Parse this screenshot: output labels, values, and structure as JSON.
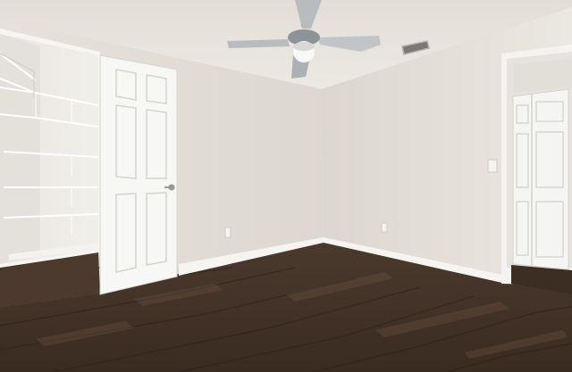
{
  "scene": {
    "description_kind": "photo",
    "room": "empty bedroom",
    "colors": {
      "ceiling": "#e9e6e0",
      "left_wall": "#e4e0d8",
      "right_wall": "#e7e3dc",
      "floor_dark": "#3a2c22",
      "floor_light": "#5a4536",
      "door": "#f7f7f5",
      "baseboard": "#f5f4f1",
      "fan_blade": "#b9bcbf",
      "shelf": "#ffffff"
    },
    "objects": [
      "ceiling-fan",
      "air-vent",
      "walk-in-closet",
      "wire-shelving",
      "open-panel-door",
      "closet-bifold-door",
      "light-switch",
      "wall-outlet",
      "laminate-floor"
    ]
  }
}
